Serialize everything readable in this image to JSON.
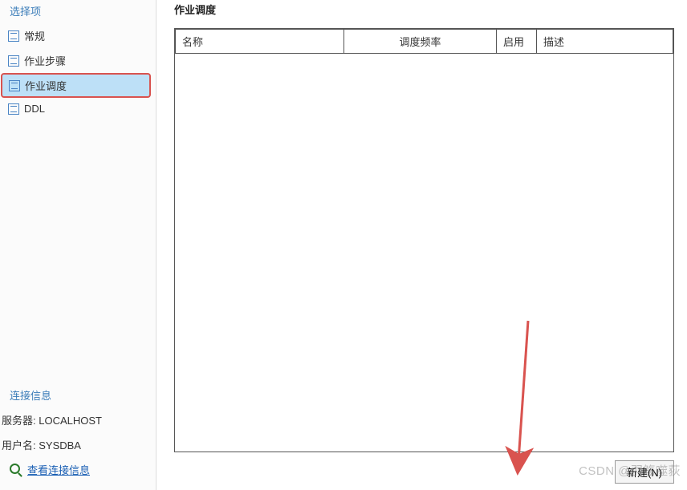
{
  "sidebar": {
    "section_title": "选择项",
    "items": [
      {
        "label": "常规"
      },
      {
        "label": "作业步骤"
      },
      {
        "label": "作业调度"
      },
      {
        "label": "DDL"
      }
    ]
  },
  "connection": {
    "section_title": "连接信息",
    "server_label": "服务器: LOCALHOST",
    "user_label": "用户名: SYSDBA",
    "view_link": "查看连接信息"
  },
  "main": {
    "title": "作业调度",
    "columns": {
      "name": "名称",
      "freq": "调度频率",
      "enable": "启用",
      "desc": "描述"
    },
    "new_button": "新建(N)"
  },
  "watermark": "CSDN @羽觞噬荻"
}
